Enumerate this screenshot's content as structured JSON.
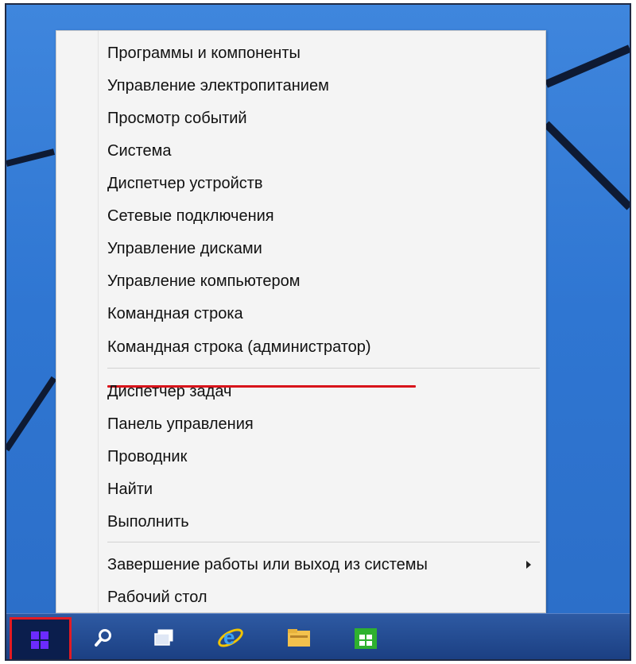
{
  "menu": {
    "group1": [
      "Программы и компоненты",
      "Управление электропитанием",
      "Просмотр событий",
      "Система",
      "Диспетчер устройств",
      "Сетевые подключения",
      "Управление дисками",
      "Управление компьютером",
      "Командная строка",
      "Командная строка (администратор)"
    ],
    "group2": [
      "Диспетчер задач",
      "Панель управления",
      "Проводник",
      "Найти",
      "Выполнить"
    ],
    "group3": [
      "Завершение работы или выход из системы",
      "Рабочий стол"
    ],
    "highlight_color": "#d8141b"
  },
  "taskbar": {
    "icons": [
      "windows-logo-icon",
      "search-icon",
      "task-view-icon",
      "internet-explorer-icon",
      "file-explorer-icon",
      "store-icon"
    ],
    "start_outline_color": "#e31b23",
    "background_color": "#1f4487"
  },
  "desktop": {
    "background_color": "#3a80d9"
  }
}
